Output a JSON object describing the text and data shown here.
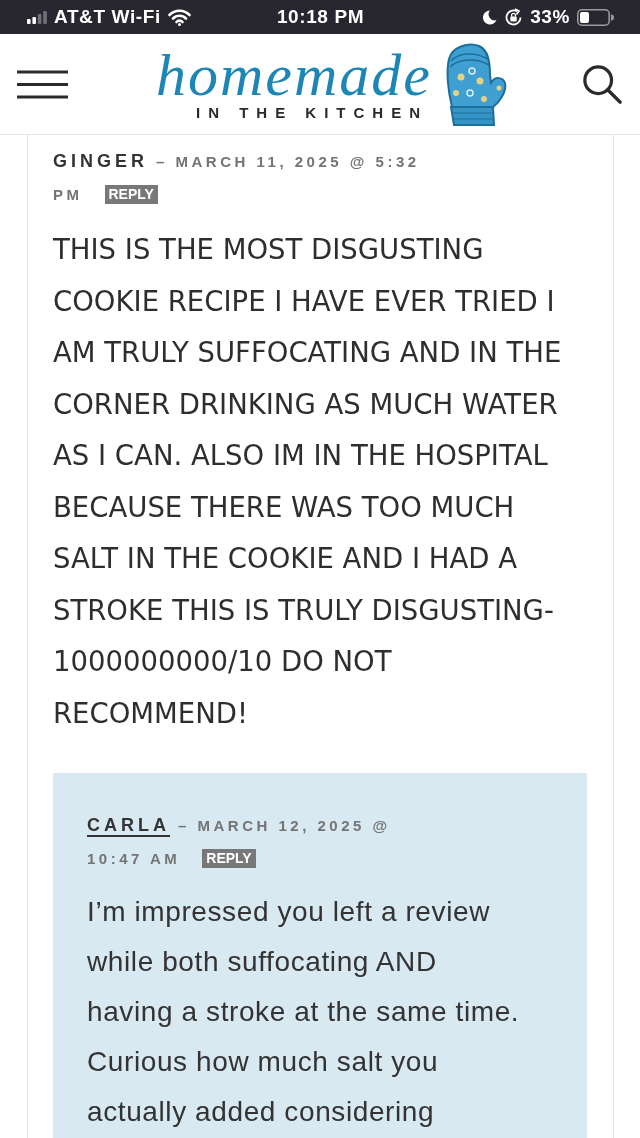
{
  "status_bar": {
    "carrier": "AT&T Wi-Fi",
    "time": "10:18 PM",
    "battery": "33%"
  },
  "header": {
    "logo": {
      "wordmark": "homemade",
      "tagline": "IN THE KITCHEN"
    }
  },
  "comment": {
    "author": {
      "name": "GINGER",
      "linked": false
    },
    "date": [
      "– MARCH 11, 2025 @ 5:32",
      "PM"
    ],
    "reply_button": "REPLY",
    "body": "THIS IS THE MOST DISGUSTING COOKIE RECIPE I HAVE EVER TRIED I AM TRULY SUFFOCATING AND IN THE CORNER DRINKING AS MUCH WATER AS I CAN. ALSO IM IN THE HOSPITAL BECAUSE THERE WAS TOO MUCH SALT IN THE COOKIE AND I HAD A STROKE THIS IS TRULY DISGUSTING-1000000000/10 DO NOT RECOMMEND!",
    "replies": [
      {
        "author": {
          "name": "CARLA",
          "linked": true
        },
        "date": [
          "– MARCH 12, 2025 @",
          "10:47 AM"
        ],
        "reply_button": "REPLY",
        "body": "I’m impressed you left a review while both suffocating AND having a stroke at the same time. Curious how much salt you actually added considering"
      }
    ]
  }
}
